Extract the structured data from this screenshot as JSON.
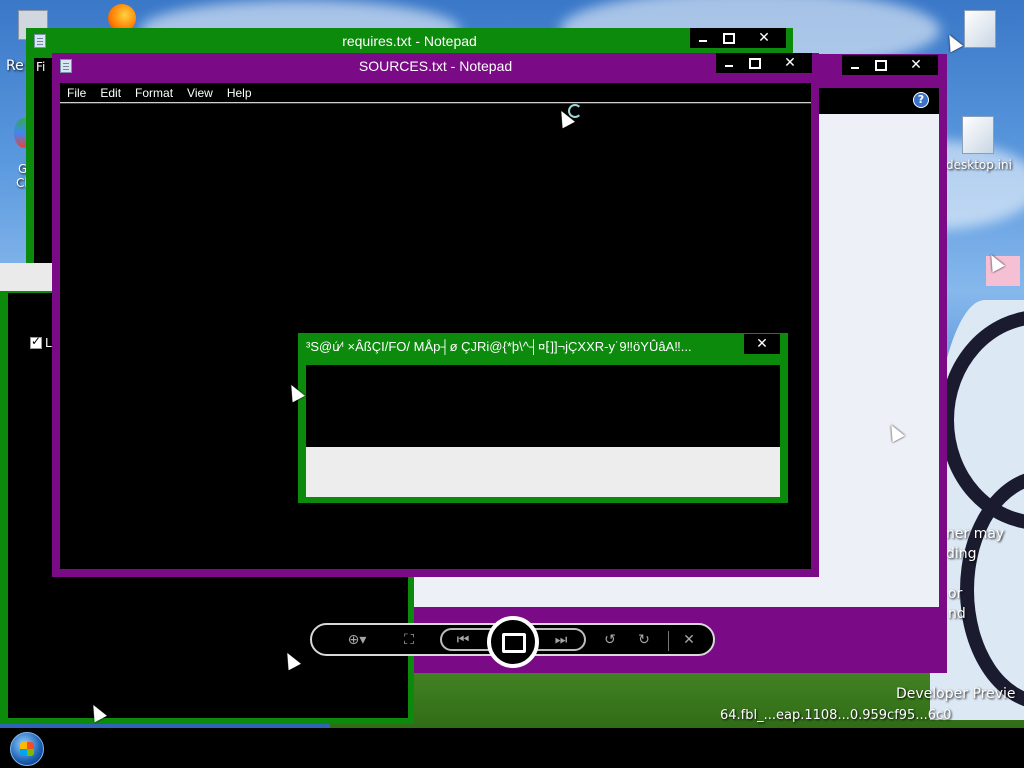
{
  "desktop": {
    "icons": [
      {
        "label": "desktop.ini"
      }
    ],
    "fragments": {
      "re": "Re",
      "go": "G",
      "ch": "Cl",
      "ner_may": "ner may",
      "ding": "ding",
      "or": "or",
      "nd": "nd",
      "dev_preview": "Developer Previe",
      "build": "64.fbl_...eap.1108...0.959cf95...6c0"
    }
  },
  "windows": {
    "requires": {
      "title": "requires.txt - Notepad",
      "menu_fragment": "Fi"
    },
    "sources": {
      "title": "SOURCES.txt - Notepad",
      "menu": [
        "File",
        "Edit",
        "Format",
        "View",
        "Help"
      ]
    },
    "left": {
      "checkbox_label": "Lo"
    },
    "viewer": {
      "help": "?"
    },
    "dialog": {
      "title": "³S@ú⁄ⁱ ×ÂßÇI/FO/ MÅp┤ø ÇJRi@{*þ\\^┤¤⁅]]¬jÇXXR-y˙9‼öYÛâA‼...",
      "close": "✕"
    }
  },
  "viewer_toolbar": {
    "zoom": "⊕▾",
    "fit": "⛶",
    "prev": "⏮",
    "next": "⏭",
    "rotate_left": "↺",
    "rotate_right": "↻",
    "delete": "✕"
  },
  "caption": {
    "min": "",
    "max": "",
    "close": "✕"
  },
  "colors": {
    "green_frame": "#0b8a0b",
    "purple_frame": "#7a0a86",
    "taskbar": "#000000"
  }
}
